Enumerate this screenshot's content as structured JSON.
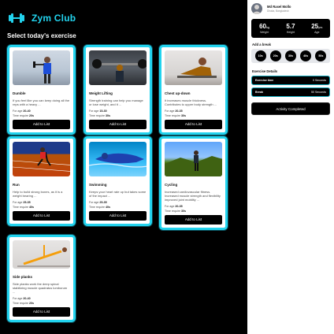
{
  "app": {
    "title": "Zym Club"
  },
  "section_title": "Select today's exercise",
  "cards": [
    {
      "title": "Dumble",
      "desc": "If you feel like you can keep doing all the reps with a heavy ...",
      "age_label": "For age",
      "age": "20-40",
      "time_label": "Time require",
      "time": "20s",
      "button": "Add to List"
    },
    {
      "title": "Weight Lifting",
      "desc": "Strength training can help you manage or lose weight, and it ...",
      "age_label": "For age",
      "age": "15-30",
      "time_label": "Time require",
      "time": "30s",
      "button": "Add to List"
    },
    {
      "title": "Chest up-down",
      "desc": "It increases muscle thickness. Contributes to upper body strength ...",
      "age_label": "For age",
      "age": "20-35",
      "time_label": "Time require",
      "time": "30s",
      "button": "Add to List"
    },
    {
      "title": "Run",
      "desc": "Help to build strong bones, as it is a weight bearing ...",
      "age_label": "For age",
      "age": "25-35",
      "time_label": "Time require",
      "time": "40s",
      "button": "Add to List"
    },
    {
      "title": "Swimming",
      "desc": "Keeps your heart rate up but takes some of the impact ...",
      "age_label": "For age",
      "age": "25-35",
      "time_label": "Time require",
      "time": "40s",
      "button": "Add to List"
    },
    {
      "title": "Cycling",
      "desc": "Increased cardiovascular fitness. Increased muscle strength and flexibility improved joint mobility ...",
      "age_label": "For age",
      "age": "20-35",
      "time_label": "Time require",
      "time": "30s",
      "button": "Add to List"
    },
    {
      "title": "Side planks",
      "desc": "Side planks work the deep spinal stabilizing muscle quadratus lumborum ...",
      "age_label": "For age",
      "age": "20-40",
      "time_label": "Time require",
      "time": "20s",
      "button": "Add to List"
    }
  ],
  "profile": {
    "name": "Md Rasel Mollo",
    "subtitle": "Dhaka, Bangladesh"
  },
  "stats": [
    {
      "value": "60",
      "unit": "kg",
      "label": "Weight"
    },
    {
      "value": "5.7",
      "unit": "",
      "label": "Height"
    },
    {
      "value": "25",
      "unit": "yrs",
      "label": "Age"
    }
  ],
  "break_title": "Add a break",
  "breaks": [
    "10s",
    "20s",
    "30s",
    "40s",
    "50s"
  ],
  "details_title": "Exercise Details",
  "details": [
    {
      "key": "Exercise time",
      "value": "0 Seconds"
    },
    {
      "key": "Break",
      "value": "50 Seconds"
    }
  ],
  "complete_button": "Activity Completed",
  "colors": {
    "accent": "#22d3ee",
    "background": "#000000",
    "panel": "#ffffff"
  }
}
